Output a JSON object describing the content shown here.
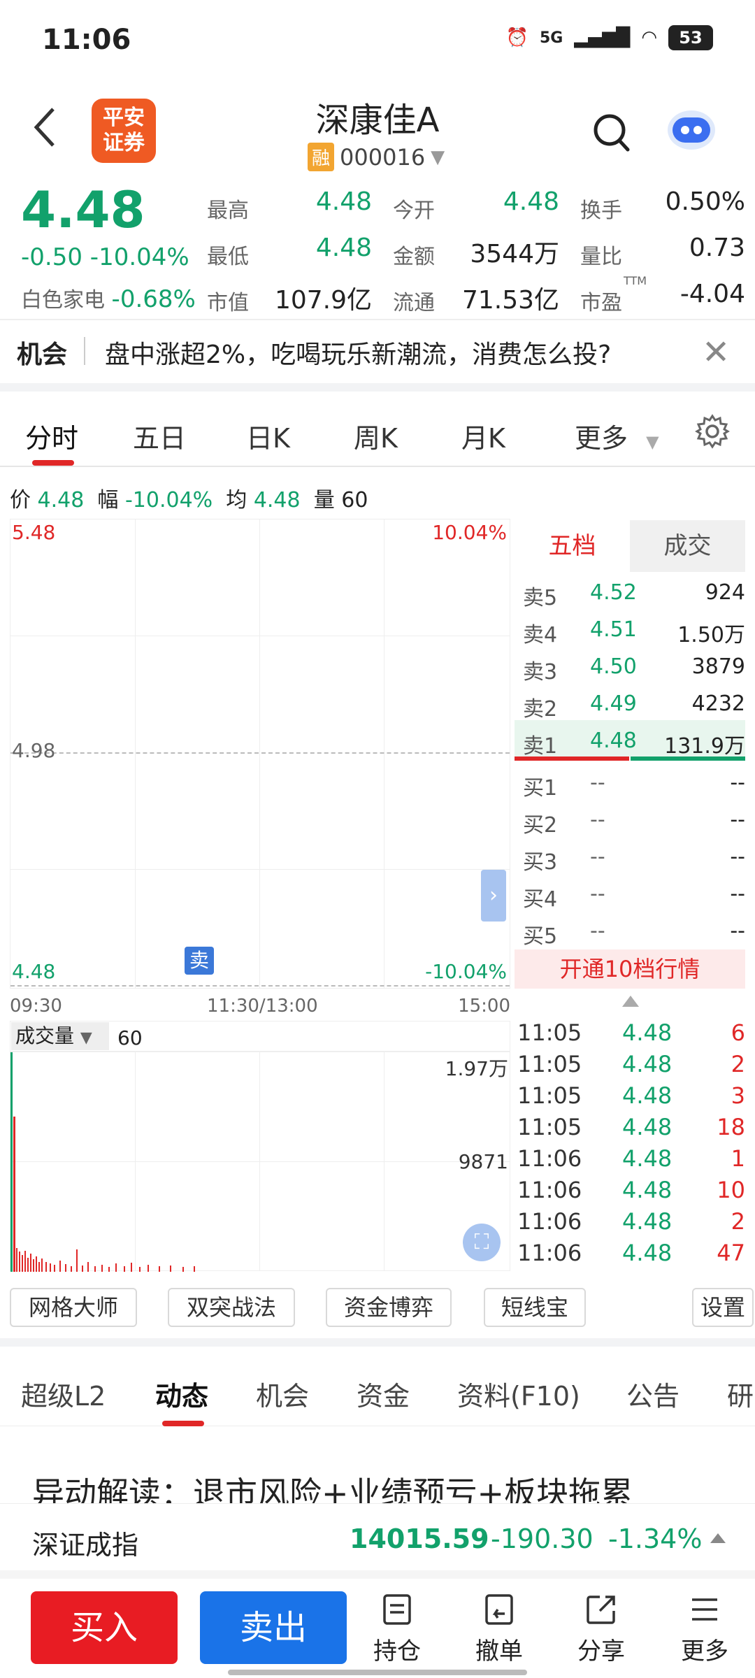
{
  "status_bar": {
    "time": "11:06",
    "network": "5G",
    "battery": "53"
  },
  "header": {
    "broker_logo_text": "平安证券",
    "stock_name": "深康佳A",
    "margin_badge": "融",
    "stock_code": "000016"
  },
  "quote": {
    "price": "4.48",
    "change": "-0.50",
    "change_pct": "-10.04%",
    "sector_name": "白色家电",
    "sector_pct": "-0.68%",
    "rows": [
      [
        {
          "label": "最高",
          "value": "4.48",
          "color": "green"
        },
        {
          "label": "今开",
          "value": "4.48",
          "color": "green"
        },
        {
          "label": "换手",
          "value": "0.50%",
          "color": "dark"
        }
      ],
      [
        {
          "label": "最低",
          "value": "4.48",
          "color": "green"
        },
        {
          "label": "金额",
          "value": "3544万",
          "color": "dark"
        },
        {
          "label": "量比",
          "value": "0.73",
          "color": "dark"
        }
      ],
      [
        {
          "label": "市值",
          "value": "107.9亿",
          "color": "dark"
        },
        {
          "label": "流通",
          "value": "71.53亿",
          "color": "dark"
        },
        {
          "label": "市盈",
          "value": "-4.04",
          "color": "dark"
        }
      ]
    ],
    "ttm_label": "TTM"
  },
  "opportunity": {
    "tag": "机会",
    "text": "盘中涨超2%，吃喝玩乐新潮流，消费怎么投?"
  },
  "chart_tabs": [
    "分时",
    "五日",
    "日K",
    "周K",
    "月K",
    "更多"
  ],
  "info_line": {
    "price_label": "价",
    "price": "4.48",
    "amp_label": "幅",
    "amp": "-10.04%",
    "avg_label": "均",
    "avg": "4.48",
    "vol_label": "量",
    "vol": "60"
  },
  "chart_axis": {
    "top_price": "5.48",
    "top_pct": "10.04%",
    "mid_price": "4.98",
    "bottom_price": "4.48",
    "bottom_pct": "-10.04%",
    "t_start": "09:30",
    "t_mid": "11:30/13:00",
    "t_end": "15:00",
    "sell_marker": "卖"
  },
  "order_book": {
    "tabs": [
      "五档",
      "成交"
    ],
    "asks": [
      {
        "label": "卖5",
        "price": "4.52",
        "vol": "924"
      },
      {
        "label": "卖4",
        "price": "4.51",
        "vol": "1.50万"
      },
      {
        "label": "卖3",
        "price": "4.50",
        "vol": "3879"
      },
      {
        "label": "卖2",
        "price": "4.49",
        "vol": "4232"
      },
      {
        "label": "卖1",
        "price": "4.48",
        "vol": "131.9万"
      }
    ],
    "bids": [
      {
        "label": "买1",
        "price": "--",
        "vol": "--"
      },
      {
        "label": "买2",
        "price": "--",
        "vol": "--"
      },
      {
        "label": "买3",
        "price": "--",
        "vol": "--"
      },
      {
        "label": "买4",
        "price": "--",
        "vol": "--"
      },
      {
        "label": "买5",
        "price": "--",
        "vol": "--"
      }
    ],
    "upgrade": "开通10档行情"
  },
  "volume_chart": {
    "selector": "成交量",
    "value": "60",
    "max_label": "1.97万",
    "mid_label": "9871"
  },
  "trades": [
    {
      "time": "11:05",
      "price": "4.48",
      "vol": "6"
    },
    {
      "time": "11:05",
      "price": "4.48",
      "vol": "2"
    },
    {
      "time": "11:05",
      "price": "4.48",
      "vol": "3"
    },
    {
      "time": "11:05",
      "price": "4.48",
      "vol": "18"
    },
    {
      "time": "11:06",
      "price": "4.48",
      "vol": "1"
    },
    {
      "time": "11:06",
      "price": "4.48",
      "vol": "10"
    },
    {
      "time": "11:06",
      "price": "4.48",
      "vol": "2"
    },
    {
      "time": "11:06",
      "price": "4.48",
      "vol": "47"
    }
  ],
  "strategy_buttons": [
    "网格大师",
    "双突战法",
    "资金博弈",
    "短线宝",
    "设置"
  ],
  "content_tabs": [
    "超级L2",
    "动态",
    "机会",
    "资金",
    "资料(F10)",
    "公告",
    "研"
  ],
  "news_headline": "异动解读：退市风险+业绩预亏+板块拖累",
  "index_ticker": {
    "name": "深证成指",
    "value": "14015.59",
    "change": "-190.30",
    "pct": "-1.34%"
  },
  "bottom_bar": {
    "buy": "买入",
    "sell": "卖出",
    "positions": "持仓",
    "cancel": "撤单",
    "share": "分享",
    "more": "更多"
  },
  "colors": {
    "up": "#e02727",
    "down": "#12a16b",
    "accent": "#1a73e8"
  }
}
